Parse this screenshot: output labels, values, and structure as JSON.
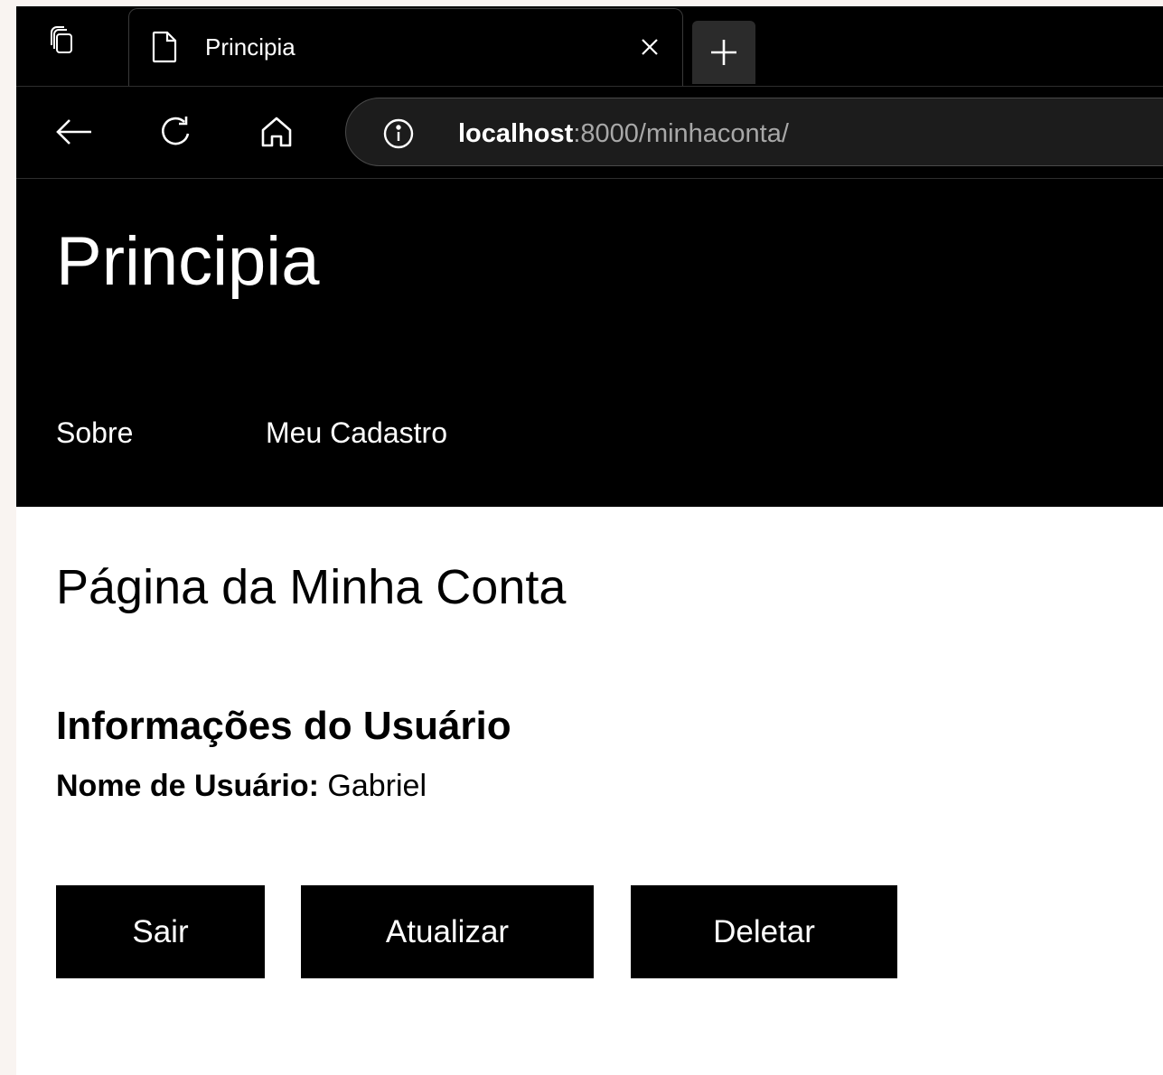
{
  "browser": {
    "tab": {
      "title": "Principia"
    },
    "address": {
      "host": "localhost",
      "rest": ":8000/minhaconta/"
    }
  },
  "site": {
    "title": "Principia",
    "nav": [
      {
        "label": "Sobre"
      },
      {
        "label": "Meu Cadastro"
      }
    ]
  },
  "main": {
    "heading": "Página da Minha Conta",
    "user_info_heading": "Informações do Usuário",
    "username_label": "Nome de Usuário:",
    "username_value": "Gabriel",
    "buttons": {
      "sair": "Sair",
      "atualizar": "Atualizar",
      "deletar": "Deletar"
    }
  }
}
